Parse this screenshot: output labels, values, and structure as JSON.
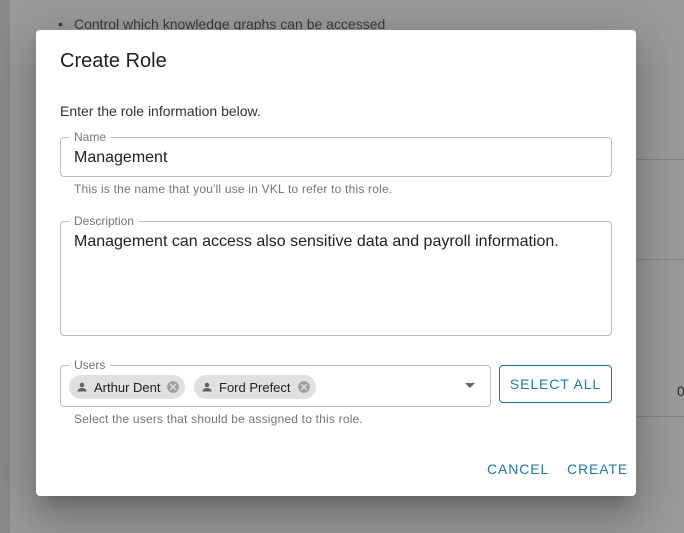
{
  "background": {
    "bullet_text": "Control which knowledge graphs can be accessed",
    "trailing_glyph": "0"
  },
  "dialog": {
    "title": "Create Role",
    "intro": "Enter the role information below.",
    "name_field": {
      "label": "Name",
      "value": "Management",
      "hint": "This is the name that you'll use in VKL to refer to this role."
    },
    "description_field": {
      "label": "Description",
      "value": "Management can access also sensitive data and payroll information."
    },
    "users_field": {
      "label": "Users",
      "chips": [
        {
          "label": "Arthur Dent",
          "icon": "person-icon"
        },
        {
          "label": "Ford Prefect",
          "icon": "person-icon"
        }
      ],
      "hint": "Select the users that should be assigned to this role."
    },
    "select_all_label": "SELECT ALL",
    "cancel_label": "CANCEL",
    "create_label": "CREATE"
  },
  "colors": {
    "accent": "#1a7ab0",
    "overlay": "#8f8f8f",
    "chip_bg": "#e0e0e0"
  }
}
